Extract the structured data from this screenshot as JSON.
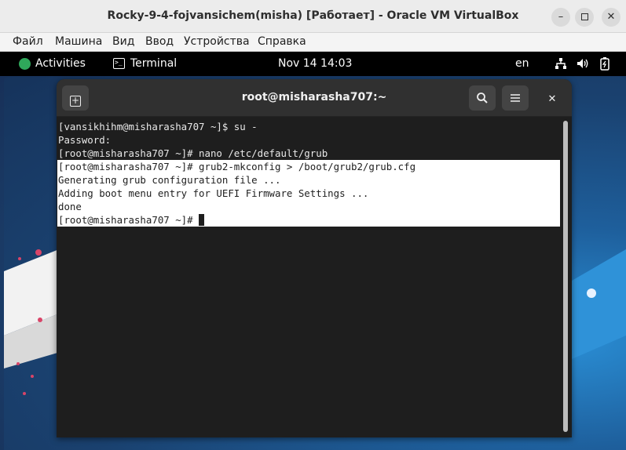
{
  "host_window": {
    "title": "Rocky-9-4-fojvansichem(misha) [Работает] - Oracle VM VirtualBox",
    "minimize": "–",
    "close": "✕"
  },
  "host_menu": [
    "Файл",
    "Машина",
    "Вид",
    "Ввод",
    "Устройства",
    "Справка"
  ],
  "gnome_bar": {
    "activities": "Activities",
    "app_name": "Terminal",
    "clock": "Nov 14  14:03",
    "keyboard_layout": "en"
  },
  "terminal": {
    "title": "root@misharasha707:~",
    "new_tab_icon": "+",
    "search_icon": "⌕",
    "menu_icon": "≡",
    "close_icon": "✕",
    "lines": [
      {
        "text": "[vansikhihm@misharasha707 ~]$ su -",
        "selected": false
      },
      {
        "text": "Password:",
        "selected": false
      },
      {
        "text": "[root@misharasha707 ~]# nano /etc/default/grub",
        "selected": false
      },
      {
        "text": "[root@misharasha707 ~]# grub2-mkconfig > /boot/grub2/grub.cfg",
        "selected": true
      },
      {
        "text": "Generating grub configuration file ...",
        "selected": true
      },
      {
        "text": "Adding boot menu entry for UEFI Firmware Settings ...",
        "selected": true
      },
      {
        "text": "done",
        "selected": true
      },
      {
        "text": "[root@misharasha707 ~]# ",
        "selected": true,
        "cursor": true
      }
    ]
  },
  "colors": {
    "terminal_bg": "#1e1e1e",
    "headerbar_bg": "#303030",
    "selection_bg": "#ffffff",
    "gnome_bar_bg": "#000000",
    "activities_accent": "#2fa85b"
  }
}
